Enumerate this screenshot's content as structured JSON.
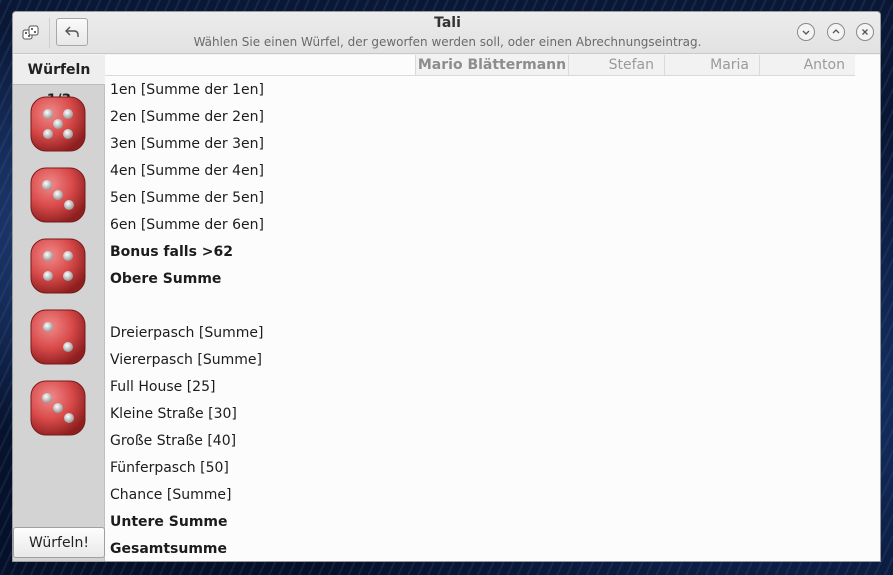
{
  "window": {
    "title": "Tali",
    "subtitle": "Wählen Sie einen Würfel, der geworfen werden soll, oder einen Abrechnungseintrag."
  },
  "dice_panel": {
    "roll_status": "Würfeln 1/3",
    "roll_button": "Würfeln!",
    "dice": [
      {
        "value": 5
      },
      {
        "value": 3
      },
      {
        "value": 4
      },
      {
        "value": 2
      },
      {
        "value": 3
      }
    ]
  },
  "players": [
    "Mario Blättermann",
    "Stefan",
    "Maria",
    "Anton"
  ],
  "rows": [
    {
      "label": "1en [Summe der 1en]",
      "bold": false
    },
    {
      "label": "2en [Summe der 2en]",
      "bold": false
    },
    {
      "label": "3en [Summe der 3en]",
      "bold": false
    },
    {
      "label": "4en [Summe der 4en]",
      "bold": false
    },
    {
      "label": "5en [Summe der 5en]",
      "bold": false
    },
    {
      "label": "6en [Summe der 6en]",
      "bold": false
    },
    {
      "label": "Bonus falls >62",
      "bold": true
    },
    {
      "label": "Obere Summe",
      "bold": true
    },
    {
      "label": "",
      "bold": false
    },
    {
      "label": "Dreierpasch [Summe]",
      "bold": false
    },
    {
      "label": "Viererpasch [Summe]",
      "bold": false
    },
    {
      "label": "Full House [25]",
      "bold": false
    },
    {
      "label": "Kleine Straße [30]",
      "bold": false
    },
    {
      "label": "Große Straße [40]",
      "bold": false
    },
    {
      "label": "Fünferpasch [50]",
      "bold": false
    },
    {
      "label": "Chance [Summe]",
      "bold": false
    },
    {
      "label": "Untere Summe",
      "bold": true
    },
    {
      "label": "Gesamtsumme",
      "bold": true
    }
  ],
  "icons": {
    "app": "dice-app-icon",
    "undo": "undo-icon",
    "minimize": "minimize-icon",
    "maximize": "maximize-icon",
    "close": "close-icon"
  },
  "colors": {
    "die_red": "#d94a4a",
    "panel_gray": "#d3d3d3"
  }
}
